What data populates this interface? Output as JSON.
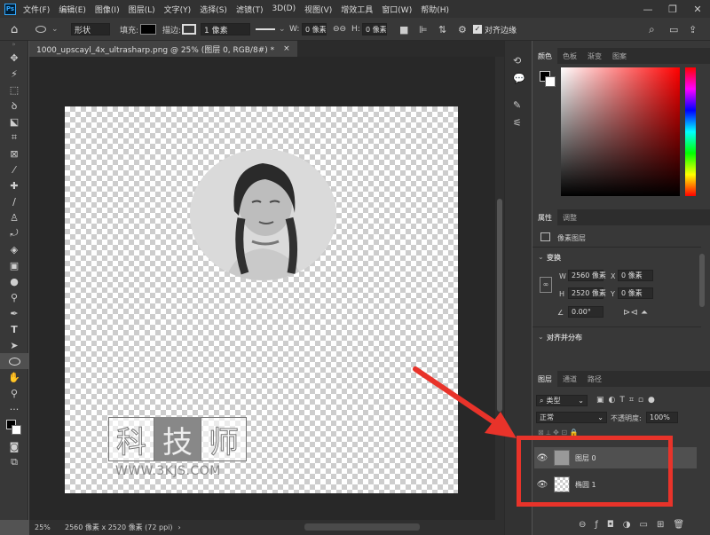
{
  "app": {
    "logo": "Ps"
  },
  "menu": [
    "文件(F)",
    "编辑(E)",
    "图像(I)",
    "图层(L)",
    "文字(Y)",
    "选择(S)",
    "滤镜(T)",
    "3D(D)",
    "视图(V)",
    "增效工具",
    "窗口(W)",
    "帮助(H)"
  ],
  "window_controls": [
    "—",
    "❐",
    "✕"
  ],
  "options": {
    "mode_value": "形状",
    "fill_label": "填充:",
    "stroke_label": "描边:",
    "stroke_width": "1 像素",
    "w_label": "W:",
    "w_value": "0 像素",
    "h_label": "H:",
    "h_value": "0 像素",
    "align_edges_label": "对齐边缘"
  },
  "tools": [
    "move",
    "artboard",
    "marquee",
    "lasso",
    "quick-select",
    "crop",
    "frame",
    "eyedropper",
    "healing",
    "brush",
    "stamp",
    "history-brush",
    "eraser",
    "gradient",
    "blur",
    "dodge",
    "pen",
    "type",
    "path-select",
    "ellipse",
    "hand",
    "zoom",
    "more",
    "colors",
    "swap",
    "quickmask",
    "screenmode"
  ],
  "document": {
    "tab_title": "1000_upscayl_4x_ultrasharp.png @ 25% (图层 0, RGB/8#) *",
    "close": "×",
    "watermark_chars": [
      "科",
      "技",
      "师"
    ],
    "watermark_url": "WWW.3KJS.COM"
  },
  "status": {
    "zoom": "25%",
    "info": "2560 像素 x 2520 像素 (72 ppi)",
    "arrow": "›"
  },
  "color_panel": {
    "tabs": [
      "颜色",
      "色板",
      "渐变",
      "图案"
    ]
  },
  "properties_panel": {
    "tabs": [
      "属性",
      "调整"
    ],
    "type_label": "像素图层",
    "transform_label": "变换",
    "w_label": "W",
    "w_value": "2560 像素",
    "x_label": "X",
    "x_value": "0 像素",
    "h_label": "H",
    "h_value": "2520 像素",
    "y_label": "Y",
    "y_value": "0 像素",
    "angle_value": "0.00°",
    "align_label": "对齐并分布"
  },
  "layers_panel": {
    "tabs": [
      "图层",
      "通道",
      "路径"
    ],
    "filter_value": "类型",
    "blend_mode": "正常",
    "opacity_label": "不透明度:",
    "opacity_value": "100%",
    "layers": [
      {
        "name": "图层 0"
      },
      {
        "name": "椭圆 1"
      }
    ]
  },
  "colors": {
    "highlight_arrow": "#e8332a",
    "accent": "#31a8ff"
  }
}
